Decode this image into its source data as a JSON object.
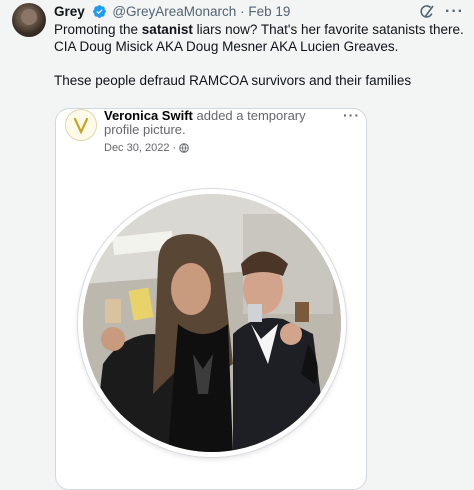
{
  "tweet": {
    "author_name": "Grey",
    "author_handle": "@GreyAreaMonarch",
    "separator": "·",
    "date": "Feb 19",
    "text_part1": "Promoting the ",
    "text_bold": "satanist",
    "text_part2": " liars now? That's her favorite satanists there. CIA Doug Misick AKA Doug Mesner AKA Lucien Greaves.",
    "text_line2": "These people defraud RAMCOA survivors and their families",
    "icons": {
      "verified": "verified-badge-icon",
      "grok": "grok-icon",
      "more": "more-icon"
    },
    "more_label": "···",
    "colors": {
      "verified": "#1d9bf0",
      "secondary_text": "#536471",
      "background": "#f3f4f4"
    }
  },
  "quoted_post": {
    "author_name": "Veronica Swift",
    "action_text": "added a temporary",
    "action_text_2": "profile picture.",
    "date": "Dec 30, 2022",
    "separator": "·",
    "privacy_icon": "globe-icon",
    "more_label": "···",
    "photo_icon": "profile-photo"
  }
}
